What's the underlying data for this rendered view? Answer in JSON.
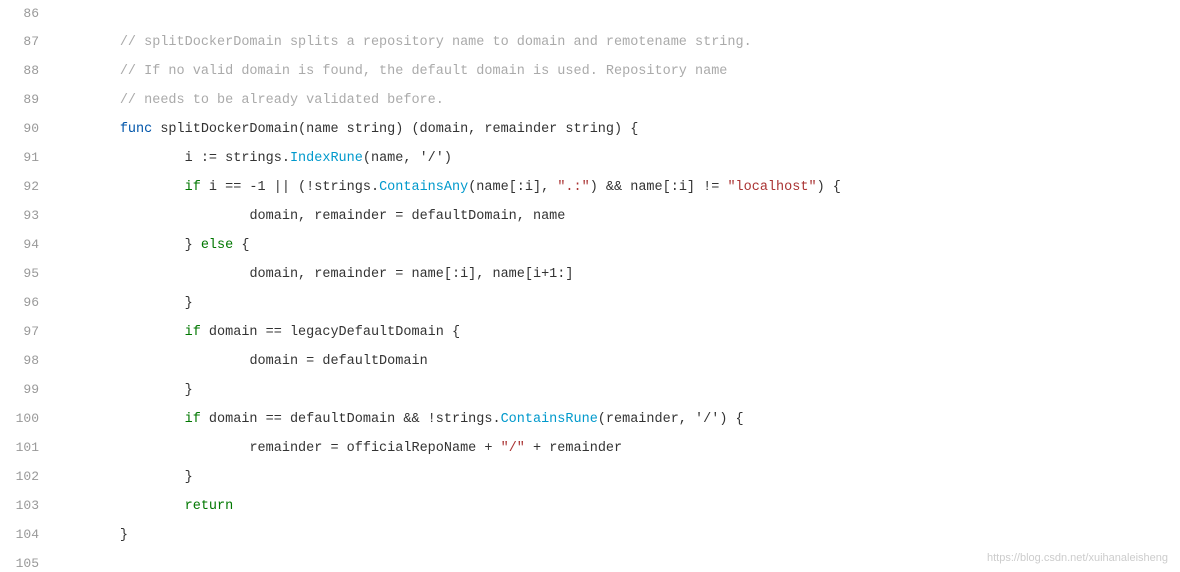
{
  "editor": {
    "background": "#ffffff",
    "watermark": "https://blog.csdn.net/xuihanaleisheng",
    "lines": [
      {
        "number": "86",
        "tokens": [
          {
            "text": "",
            "type": "plain"
          }
        ]
      },
      {
        "number": "87",
        "tokens": [
          {
            "text": "\t// splitDockerDomain splits a repository name to domain and remotename string.",
            "type": "comment"
          }
        ]
      },
      {
        "number": "88",
        "tokens": [
          {
            "text": "\t// If no valid domain is found, the default domain is used. Repository name",
            "type": "comment"
          }
        ]
      },
      {
        "number": "89",
        "tokens": [
          {
            "text": "\t// needs to be already validated before.",
            "type": "comment"
          }
        ]
      },
      {
        "number": "90",
        "tokens": [
          {
            "text": "\t",
            "type": "plain"
          },
          {
            "text": "func",
            "type": "kw-blue"
          },
          {
            "text": " splitDockerDomain(name string) (domain, remainder string) {",
            "type": "plain"
          }
        ]
      },
      {
        "number": "91",
        "tokens": [
          {
            "text": "\t\ti := strings.",
            "type": "plain"
          },
          {
            "text": "IndexRune",
            "type": "fn-call"
          },
          {
            "text": "(name, '/')",
            "type": "plain"
          }
        ]
      },
      {
        "number": "92",
        "tokens": [
          {
            "text": "\t\t",
            "type": "plain"
          },
          {
            "text": "if",
            "type": "kw-green"
          },
          {
            "text": " i == -1 || (!strings.",
            "type": "plain"
          },
          {
            "text": "ContainsAny",
            "type": "fn-call"
          },
          {
            "text": "(name[:i], ",
            "type": "plain"
          },
          {
            "text": "\".:\"",
            "type": "string"
          },
          {
            "text": ") && name[:i] != ",
            "type": "plain"
          },
          {
            "text": "\"localhost\"",
            "type": "string"
          },
          {
            "text": ") {",
            "type": "plain"
          }
        ]
      },
      {
        "number": "93",
        "tokens": [
          {
            "text": "\t\t\tdomain, remainder = defaultDomain, name",
            "type": "plain"
          }
        ]
      },
      {
        "number": "94",
        "tokens": [
          {
            "text": "\t\t} ",
            "type": "plain"
          },
          {
            "text": "else",
            "type": "kw-green"
          },
          {
            "text": " {",
            "type": "plain"
          }
        ]
      },
      {
        "number": "95",
        "tokens": [
          {
            "text": "\t\t\tdomain, remainder = name[:i], name[i+1:]",
            "type": "plain"
          }
        ]
      },
      {
        "number": "96",
        "tokens": [
          {
            "text": "\t\t}",
            "type": "plain"
          }
        ]
      },
      {
        "number": "97",
        "tokens": [
          {
            "text": "\t\t",
            "type": "plain"
          },
          {
            "text": "if",
            "type": "kw-green"
          },
          {
            "text": " domain == legacyDefaultDomain {",
            "type": "plain"
          }
        ]
      },
      {
        "number": "98",
        "tokens": [
          {
            "text": "\t\t\tdomain = defaultDomain",
            "type": "plain"
          }
        ]
      },
      {
        "number": "99",
        "tokens": [
          {
            "text": "\t\t}",
            "type": "plain"
          }
        ]
      },
      {
        "number": "100",
        "tokens": [
          {
            "text": "\t\t",
            "type": "plain"
          },
          {
            "text": "if",
            "type": "kw-green"
          },
          {
            "text": " domain == defaultDomain && !strings.",
            "type": "plain"
          },
          {
            "text": "ContainsRune",
            "type": "fn-call"
          },
          {
            "text": "(remainder, '/') {",
            "type": "plain"
          }
        ]
      },
      {
        "number": "101",
        "tokens": [
          {
            "text": "\t\t\tremainder = officialRepoName + ",
            "type": "plain"
          },
          {
            "text": "\"/\"",
            "type": "string"
          },
          {
            "text": " + remainder",
            "type": "plain"
          }
        ]
      },
      {
        "number": "102",
        "tokens": [
          {
            "text": "\t\t}",
            "type": "plain"
          }
        ]
      },
      {
        "number": "103",
        "tokens": [
          {
            "text": "\t\t",
            "type": "plain"
          },
          {
            "text": "return",
            "type": "kw-green"
          }
        ]
      },
      {
        "number": "104",
        "tokens": [
          {
            "text": "\t}",
            "type": "plain"
          }
        ]
      },
      {
        "number": "105",
        "tokens": [
          {
            "text": "",
            "type": "plain"
          }
        ]
      }
    ]
  }
}
